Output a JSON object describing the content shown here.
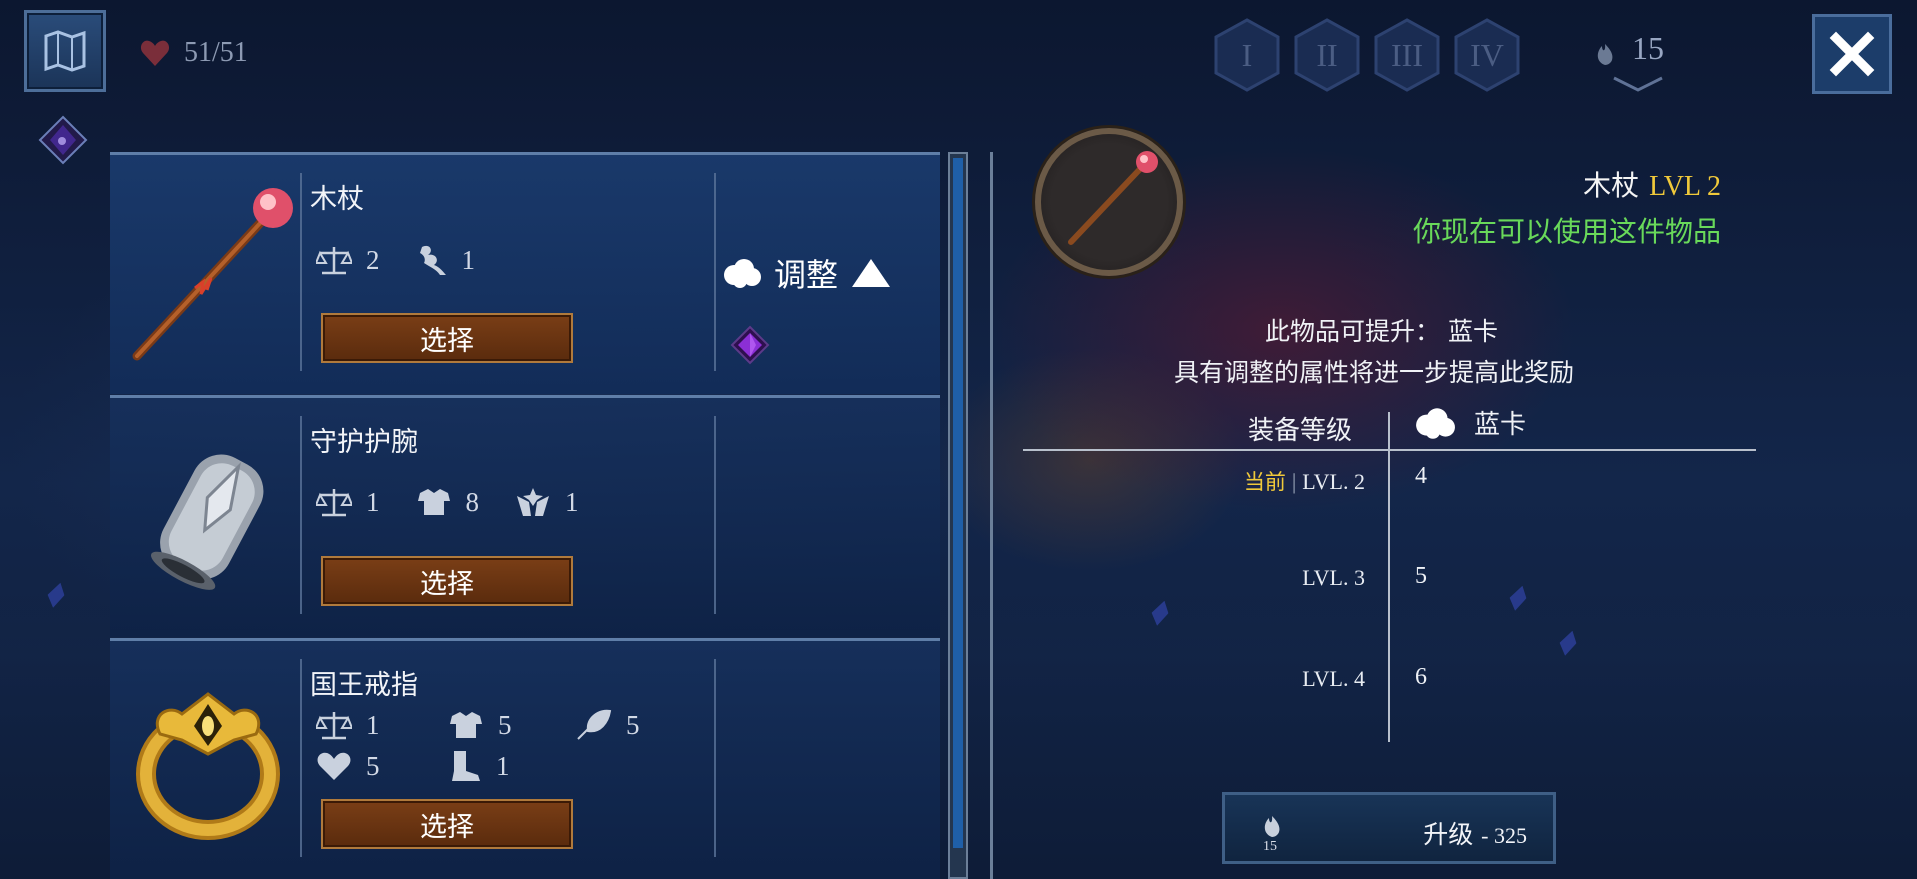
{
  "hud": {
    "health": "51/51",
    "tiers": [
      "I",
      "II",
      "III",
      "IV"
    ],
    "souls": "15"
  },
  "items": [
    {
      "name": "木杖",
      "stats": [
        {
          "icon": "balance-scale-icon",
          "value": "2"
        },
        {
          "icon": "arcane-hand-icon",
          "value": "1"
        }
      ],
      "select_label": "选择",
      "attunement_label": "调整"
    },
    {
      "name": "守护护腕",
      "stats": [
        {
          "icon": "balance-scale-icon",
          "value": "1"
        },
        {
          "icon": "armor-icon",
          "value": "8"
        },
        {
          "icon": "holy-hands-icon",
          "value": "1"
        }
      ],
      "select_label": "选择"
    },
    {
      "name": "国王戒指",
      "stats": [
        {
          "icon": "balance-scale-icon",
          "value": "1"
        },
        {
          "icon": "armor-icon",
          "value": "5"
        },
        {
          "icon": "feather-icon",
          "value": "5"
        },
        {
          "icon": "heart-icon",
          "value": "5"
        },
        {
          "icon": "boot-icon",
          "value": "1"
        }
      ],
      "select_label": "选择"
    }
  ],
  "detail": {
    "item_name": "木杖",
    "level": "LVL 2",
    "usable_text": "你现在可以使用这件物品",
    "upgrade_line1": "此物品可提升：  蓝卡",
    "upgrade_line2": "具有调整的属性将进一步提高此奖励",
    "table_header_level": "装备等级",
    "table_header_stat": "蓝卡",
    "current_label": "当前",
    "rows": [
      {
        "level": "LVL. 2",
        "value": "4"
      },
      {
        "level": "LVL. 3",
        "value": "5"
      },
      {
        "level": "LVL. 4",
        "value": "6"
      }
    ]
  },
  "upgrade_button": {
    "label": "升级",
    "cost": "- 325",
    "souls": "15"
  },
  "colors": {
    "accent_gold": "#f0c93a",
    "usable_green": "#69d95a",
    "select_button": "#6a3411"
  }
}
